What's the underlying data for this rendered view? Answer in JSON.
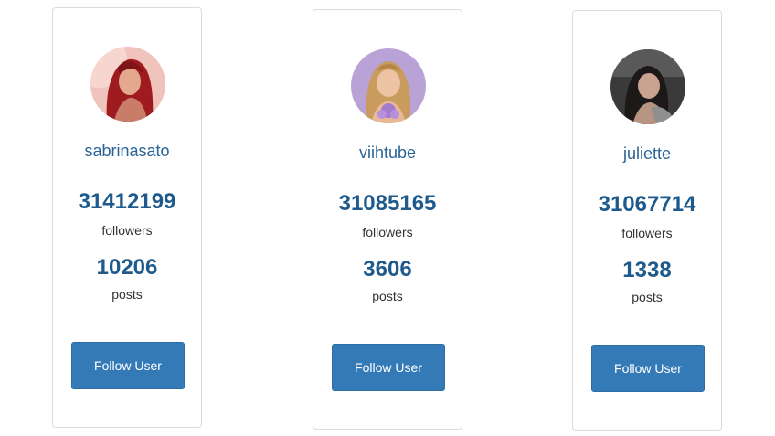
{
  "users": [
    {
      "username": "sabrinasato",
      "followers": "31412199",
      "followers_label": "followers",
      "posts": "10206",
      "posts_label": "posts",
      "button_label": "Follow User"
    },
    {
      "username": "viihtube",
      "followers": "31085165",
      "followers_label": "followers",
      "posts": "3606",
      "posts_label": "posts",
      "button_label": "Follow User"
    },
    {
      "username": "juliette",
      "followers": "31067714",
      "followers_label": "followers",
      "posts": "1338",
      "posts_label": "posts",
      "button_label": "Follow User"
    }
  ],
  "colors": {
    "accent": "#337ab7",
    "username": "#2a6496",
    "count": "#1f5a8c",
    "label": "#333333"
  }
}
